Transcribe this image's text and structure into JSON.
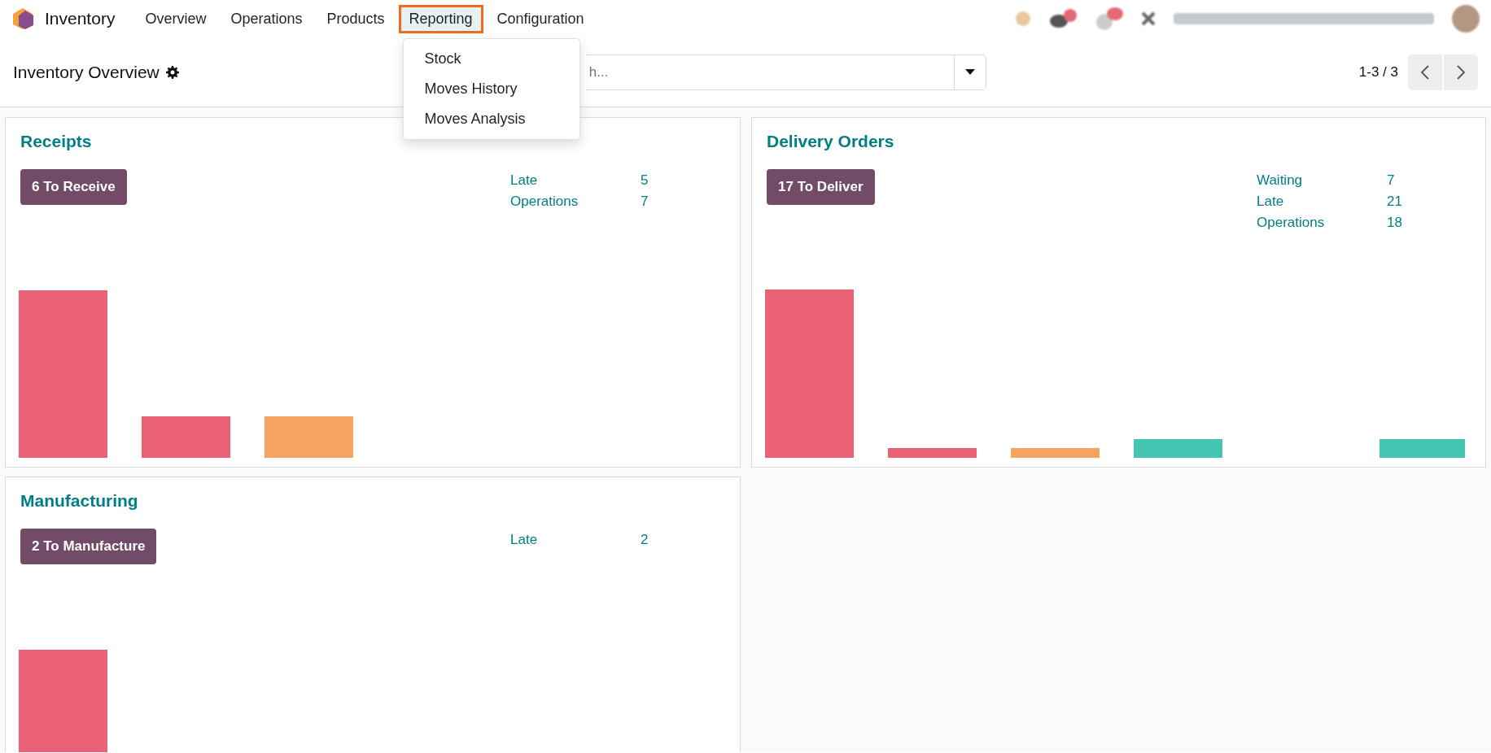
{
  "navbar": {
    "app_name": "Inventory",
    "menu": [
      {
        "label": "Overview",
        "selected": false
      },
      {
        "label": "Operations",
        "selected": false
      },
      {
        "label": "Products",
        "selected": false
      },
      {
        "label": "Reporting",
        "selected": true
      },
      {
        "label": "Configuration",
        "selected": false
      }
    ],
    "dropdown": {
      "items": [
        "Stock",
        "Moves History",
        "Moves Analysis"
      ]
    }
  },
  "control_panel": {
    "title": "Inventory Overview",
    "search": {
      "placeholder": "h..."
    },
    "pager": {
      "range": "1-3 / 3"
    }
  },
  "cards": [
    {
      "title": "Receipts",
      "action": "6 To Receive",
      "stats": [
        {
          "label": "Late",
          "value": "5"
        },
        {
          "label": "Operations",
          "value": "7"
        }
      ]
    },
    {
      "title": "Delivery Orders",
      "action": "17 To Deliver",
      "stats": [
        {
          "label": "Waiting",
          "value": "7"
        },
        {
          "label": "Late",
          "value": "21"
        },
        {
          "label": "Operations",
          "value": "18"
        }
      ]
    },
    {
      "title": "Manufacturing",
      "action": "2 To Manufacture",
      "stats": [
        {
          "label": "Late",
          "value": "2"
        }
      ]
    }
  ]
}
